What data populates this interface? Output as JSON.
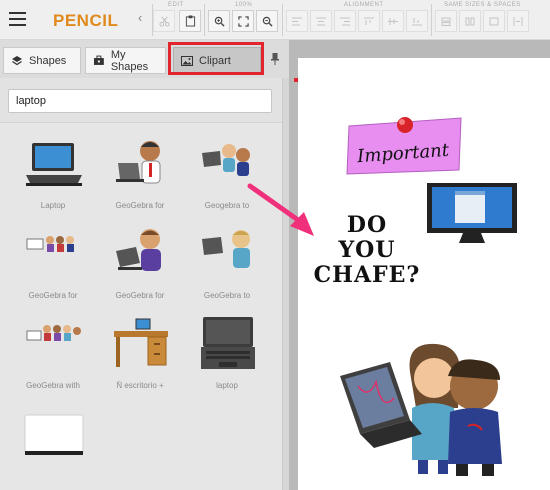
{
  "app": {
    "title": "PENCIL"
  },
  "toolbar": {
    "groups": {
      "edit": "EDIT",
      "zoom": "100%",
      "alignment": "ALIGNMENT",
      "same_size": "SAME SIZES & SPACES"
    }
  },
  "tabs": [
    {
      "label": "Shapes",
      "icon": "layers-icon"
    },
    {
      "label": "My Shapes",
      "icon": "toolbox-icon"
    },
    {
      "label": "Clipart",
      "icon": "image-icon",
      "active": true
    }
  ],
  "search": {
    "value": "laptop"
  },
  "clipart": [
    {
      "label": "Laptop"
    },
    {
      "label": "GeoGebra for"
    },
    {
      "label": "Geogebra to"
    },
    {
      "label": "GeoGebra for"
    },
    {
      "label": "GeoGebra for"
    },
    {
      "label": "GeoGebra to"
    },
    {
      "label": "GeoGebra with"
    },
    {
      "label": "Ñ escritorio +"
    },
    {
      "label": "laptop"
    },
    {
      "label": ""
    }
  ],
  "canvas": {
    "sticky_note_text": "Important",
    "headline_lines": [
      "DO",
      "YOU",
      "CHAFE?"
    ]
  },
  "colors": {
    "accent": "#e08a1e",
    "highlight": "#e2252c",
    "arrow": "#f0307a",
    "sticky": "#e78ef0"
  }
}
